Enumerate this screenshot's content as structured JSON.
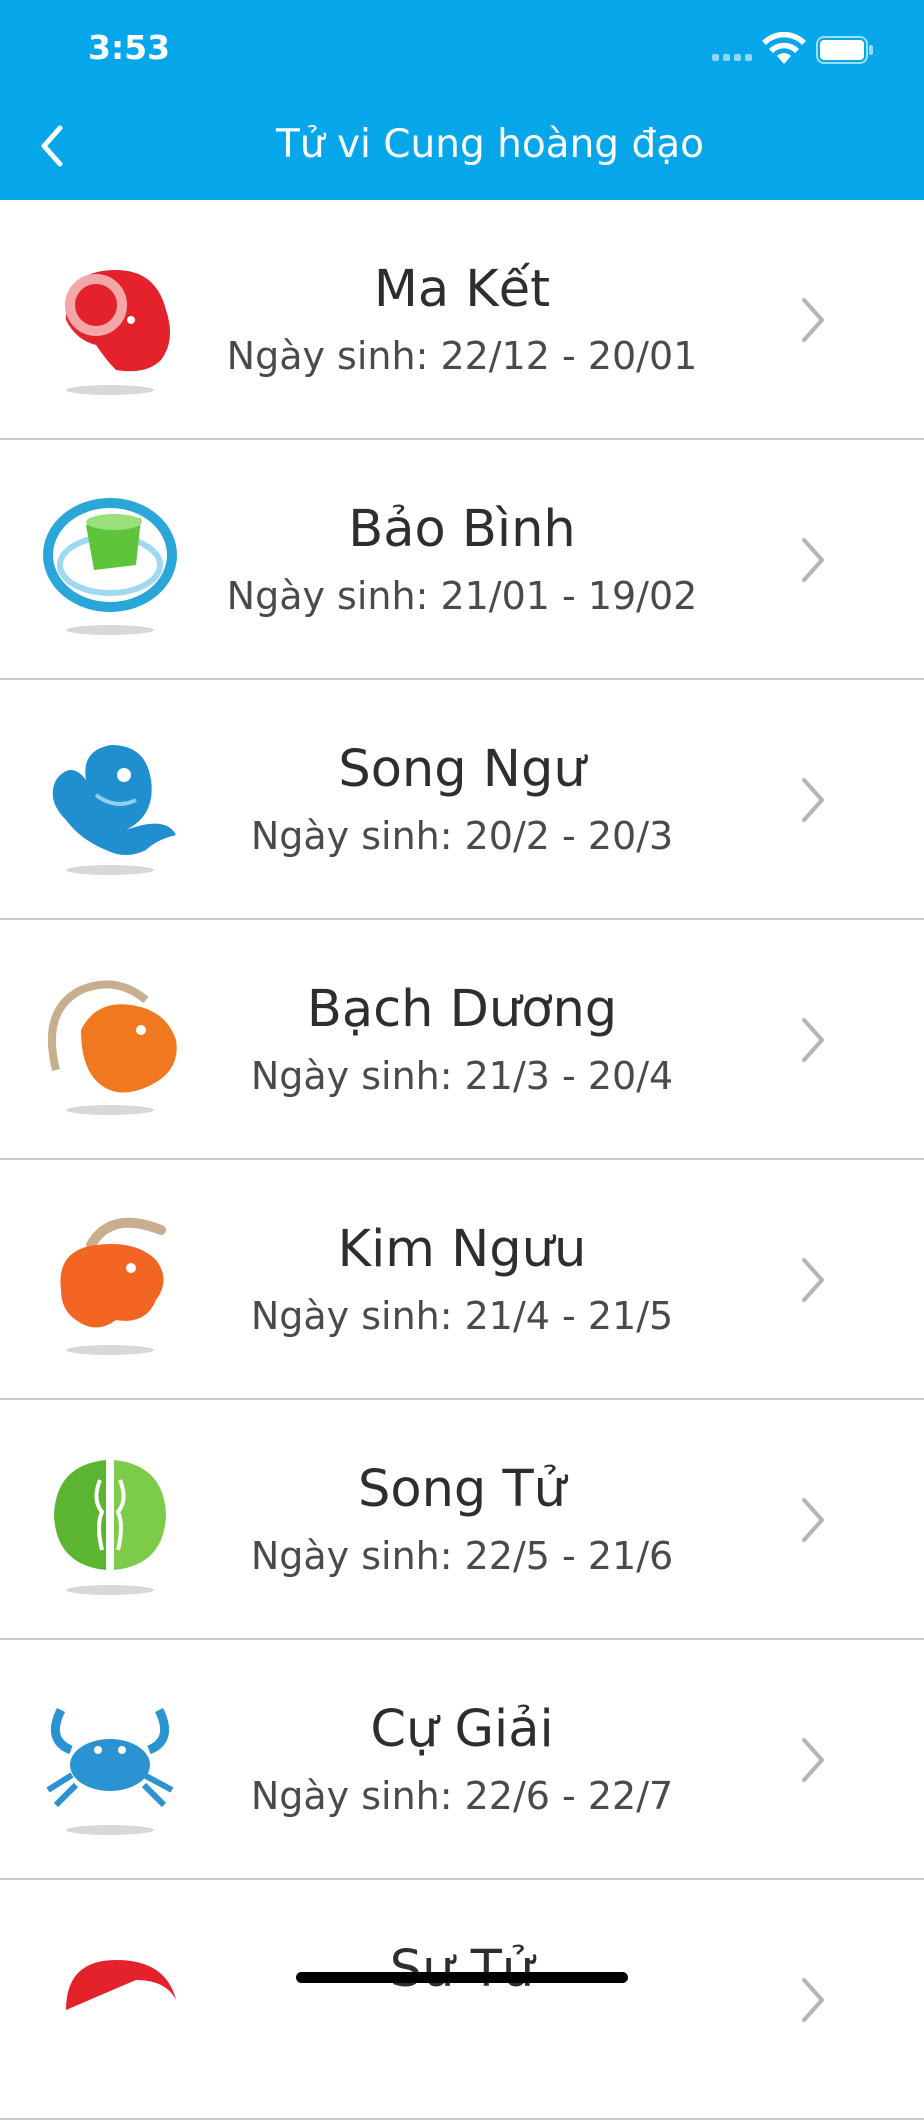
{
  "status_bar": {
    "time": "3:53",
    "wifi_icon": "wifi-icon",
    "battery_icon": "battery-icon"
  },
  "nav": {
    "title": "Tử vi Cung hoàng đạo",
    "back_icon": "chevron-left-icon"
  },
  "colors": {
    "header": "#05a7ea",
    "divider": "#c9c9c9",
    "text_primary": "#2e2e2e",
    "chevron": "#b5b5b5"
  },
  "signs": [
    {
      "name": "Ma Kết",
      "dates": "Ngày sinh: 22/12 - 20/01",
      "icon": "capricorn-ram-icon",
      "color": "#e3222c"
    },
    {
      "name": "Bảo Bình",
      "dates": "Ngày sinh: 21/01 - 19/02",
      "icon": "aquarius-urn-icon",
      "color": "#2aa6d9"
    },
    {
      "name": "Song Ngư",
      "dates": "Ngày sinh: 20/2 - 20/3",
      "icon": "pisces-fish-icon",
      "color": "#1f8fd0"
    },
    {
      "name": "Bạch Dương",
      "dates": "Ngày sinh: 21/3 - 20/4",
      "icon": "aries-goat-icon",
      "color": "#f0781e"
    },
    {
      "name": "Kim Ngưu",
      "dates": "Ngày sinh: 21/4 - 21/5",
      "icon": "taurus-bull-icon",
      "color": "#f26522"
    },
    {
      "name": "Song Tử",
      "dates": "Ngày sinh: 22/5 - 21/6",
      "icon": "gemini-twins-icon",
      "color": "#5cb531"
    },
    {
      "name": "Cự Giải",
      "dates": "Ngày sinh: 22/6 - 22/7",
      "icon": "cancer-crab-icon",
      "color": "#2b93d1"
    },
    {
      "name": "Sư Tử",
      "dates": "",
      "icon": "leo-lion-icon",
      "color": "#e3222c"
    }
  ]
}
